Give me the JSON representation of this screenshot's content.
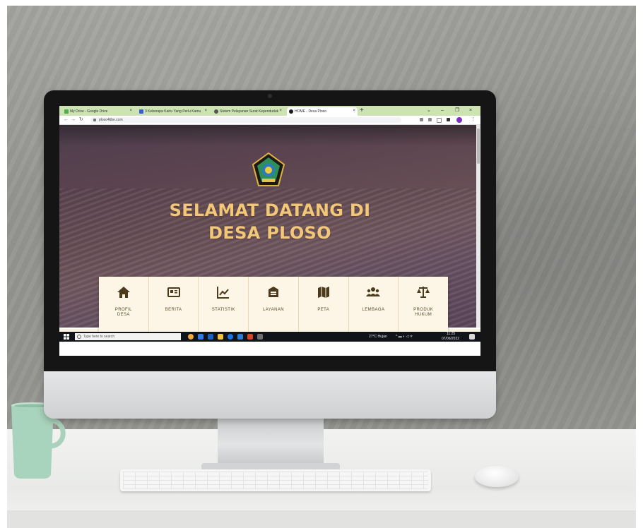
{
  "browser": {
    "tabs": [
      {
        "label": "My Drive - Google Drive",
        "favicon_color": "#4caf50"
      },
      {
        "label": "3 Keberapa Kartu Yang Perlu Kamu",
        "favicon_color": "#3b5bdb"
      },
      {
        "label": "Sistem Pelayanan Surat Kependuduk",
        "favicon_color": "#555555"
      },
      {
        "label": "HOME - Desa Ploso",
        "favicon_color": "#1b1b1b"
      }
    ],
    "url": "ploso4tibe.com",
    "tabbar_color": "#cde3b2"
  },
  "site": {
    "heading_line1": "SELAMAT DATANG DI",
    "heading_line2": "DESA PLOSO",
    "heading_color": "#f2c777",
    "menu": [
      {
        "label": "PROFIL\nDESA",
        "icon": "home-icon"
      },
      {
        "label": "BERITA",
        "icon": "newspaper-icon"
      },
      {
        "label": "STATISTIK",
        "icon": "chart-icon"
      },
      {
        "label": "LAYANAN",
        "icon": "service-box-icon"
      },
      {
        "label": "PETA",
        "icon": "map-icon"
      },
      {
        "label": "LEMBAGA",
        "icon": "users-icon"
      },
      {
        "label": "PRODUK\nHUKUM",
        "icon": "balance-scale-icon"
      }
    ]
  },
  "taskbar": {
    "search_placeholder": "Type here to search",
    "weather": "27°C Hujan",
    "time": "11:25",
    "date": "07/06/2022"
  }
}
